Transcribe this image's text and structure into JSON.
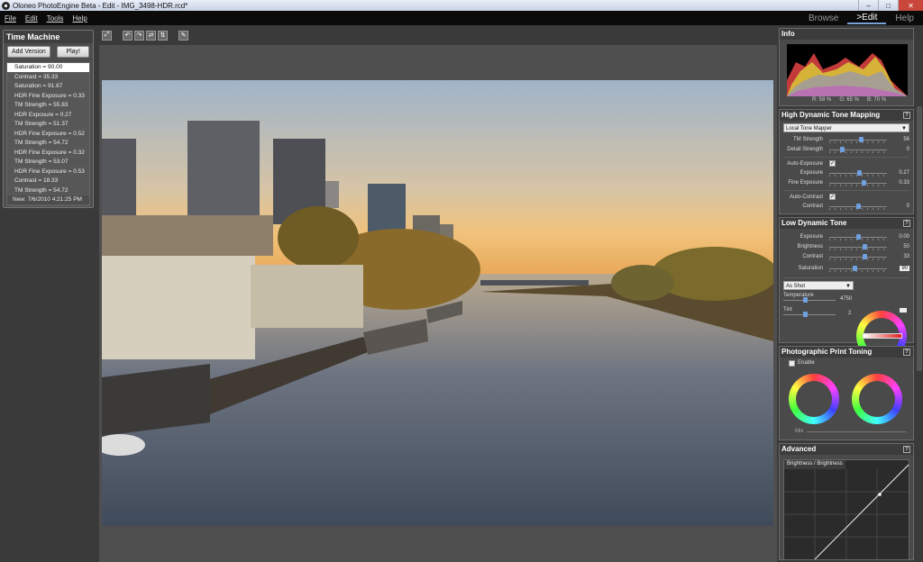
{
  "window": {
    "title": "Oloneo PhotoEngine Beta - Edit - IMG_3498-HDR.rcd*"
  },
  "menu": {
    "file": "File",
    "edit": "Edit",
    "tools": "Tools",
    "help": "Help"
  },
  "modes": {
    "browse": "Browse",
    "edit": ">Edit",
    "help": "Help"
  },
  "time_machine": {
    "title": "Time Machine",
    "add_version": "Add Version",
    "play": "Play!",
    "items": [
      "Saturation = 90.00",
      "Contrast = 35.33",
      "Saturation = 91.67",
      "HDR Fine Exposure = 0.33",
      "TM Strength = 55.83",
      "HDR Exposure = 0.27",
      "TM Strength = 51.37",
      "HDR Fine Exposure = 0.52",
      "TM Strength = 54.72",
      "HDR Fine Exposure = 0.32",
      "TM Strength = 53.07",
      "HDR Fine Exposure = 0.53",
      "Contrast = 18.33",
      "TM Strength = 54.72"
    ],
    "new_item": "New: 7/6/2010 4:21:25 PM"
  },
  "info": {
    "title": "Info",
    "r": "R: 58 %",
    "g": "G: 65 %",
    "b": "B: 70 %"
  },
  "hdr": {
    "title": "High Dynamic Tone Mapping",
    "help": "?",
    "mapper": "Local Tone Mapper",
    "tm_strength_label": "TM Strength",
    "tm_strength_value": "56",
    "detail_label": "Detail Strength",
    "detail_value": "0",
    "auto_exposure_label": "Auto-Exposure",
    "exposure_label": "Exposure",
    "exposure_value": "0.27",
    "fine_exposure_label": "Fine Exposure",
    "fine_exposure_value": "0.33",
    "auto_contrast_label": "Auto-Contrast",
    "contrast_label": "Contrast",
    "contrast_value": "0"
  },
  "ldr": {
    "title": "Low Dynamic Tone",
    "help": "?",
    "exposure_label": "Exposure",
    "exposure_value": "0.00",
    "brightness_label": "Brightness",
    "brightness_value": "50",
    "contrast_label": "Contrast",
    "contrast_value": "33",
    "saturation_label": "Saturation",
    "saturation_value": "90",
    "wb_preset": "As Shot",
    "temperature_label": "Temperature",
    "temperature_value": "4750",
    "tint_label": "Tint",
    "tint_value": "2"
  },
  "toning": {
    "title": "Photographic Print Toning",
    "help": "?",
    "enable_label": "Enable",
    "mix_label": "Mix"
  },
  "advanced": {
    "title": "Advanced",
    "help": "?",
    "curve_tab": "Brightness / Brightness"
  },
  "colors": {
    "accent": "#6fa0e0",
    "panel": "#4a4a4a",
    "background": "#2e2e2e"
  },
  "sliders": {
    "hdr_tm_strength": 0.56,
    "hdr_detail": 0.22,
    "hdr_exposure": 0.52,
    "hdr_fine_exposure": 0.6,
    "hdr_contrast": 0.5,
    "ldr_exposure": 0.5,
    "ldr_brightness": 0.62,
    "ldr_contrast": 0.62,
    "ldr_saturation": 0.45,
    "ldr_temperature": 0.42,
    "ldr_tint": 0.42
  }
}
